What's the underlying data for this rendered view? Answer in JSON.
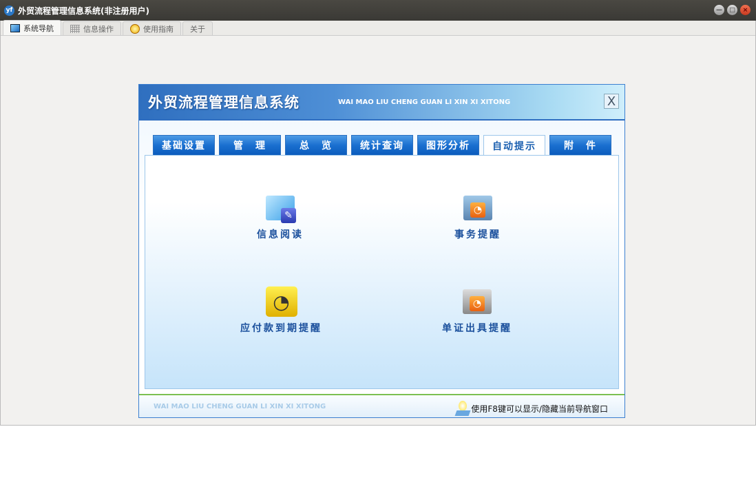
{
  "window": {
    "title": "外贸流程管理信息系统(非注册用户)",
    "logo": "yf"
  },
  "tabs": [
    {
      "label": "系统导航",
      "icon": "monitor-icon"
    },
    {
      "label": "信息操作",
      "icon": "grid-icon"
    },
    {
      "label": "使用指南",
      "icon": "help-icon"
    },
    {
      "label": "关于"
    }
  ],
  "panel": {
    "title": "外贸流程管理信息系统",
    "subtitle": "WAI MAO LIU CHENG GUAN LI XIN XI XITONG",
    "close": "X",
    "nav_tabs": [
      "基础设置",
      "管　理",
      "总　览",
      "统计查询",
      "图形分析",
      "自动提示",
      "附　件"
    ],
    "active_tab": 5,
    "items": [
      {
        "label": "信息阅读",
        "icon": "folder-read-icon"
      },
      {
        "label": "事务提醒",
        "icon": "rss-folder-icon"
      },
      {
        "label": "应付款到期提醒",
        "icon": "rss-icon"
      },
      {
        "label": "单证出具提醒",
        "icon": "rss-folder-icon"
      }
    ],
    "footer_sub": "WAI MAO LIU CHENG GUAN LI XIN XI XITONG",
    "hint": "使用F8键可以显示/隐藏当前导航窗口"
  }
}
